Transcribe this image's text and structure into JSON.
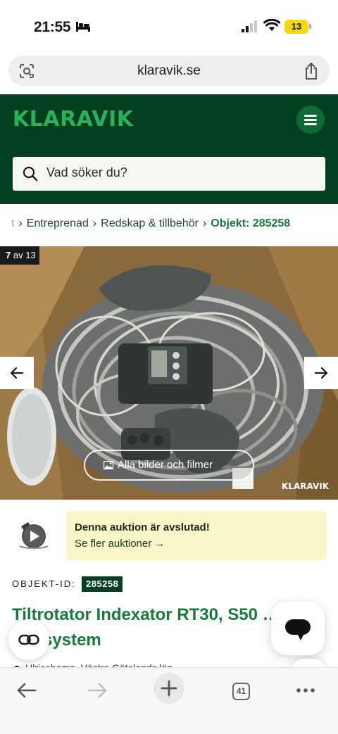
{
  "status_bar": {
    "time": "21:55",
    "battery": "13"
  },
  "browser": {
    "url": "klaravik.se"
  },
  "header": {
    "logo": "KLARAVIK",
    "search_placeholder": "Vad söker du?"
  },
  "breadcrumb": {
    "items": [
      {
        "label": "t",
        "faded": true
      },
      {
        "label": "Entreprenad"
      },
      {
        "label": "Redskap & tillbehör"
      },
      {
        "label": "Objekt: 285258",
        "current": true
      }
    ]
  },
  "gallery": {
    "current": "7",
    "of": "av 13",
    "all_images_label": "Alla bilder och filmer",
    "watermark": "KLARAVIK"
  },
  "notice": {
    "title": "Denna auktion är avslutad!",
    "link": "Se fler auktioner →"
  },
  "object": {
    "id_label": "OBJEKT-ID:",
    "id": "285258",
    "title": "Tiltrotator Indexator RT30, S50 … styrsystem",
    "location": "Ulricehamn, Västra Götalands län"
  },
  "toolbar": {
    "tab_count": "41"
  }
}
